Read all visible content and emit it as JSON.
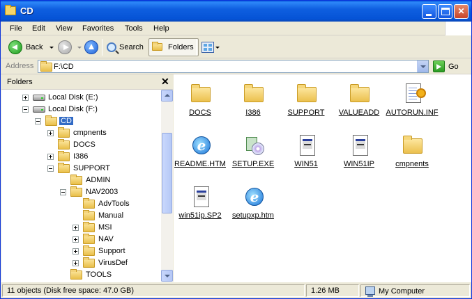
{
  "window": {
    "title": "CD"
  },
  "menu": [
    "File",
    "Edit",
    "View",
    "Favorites",
    "Tools",
    "Help"
  ],
  "toolbar": {
    "back_label": "Back",
    "search_label": "Search",
    "folders_label": "Folders"
  },
  "address": {
    "label": "Address",
    "value": "F:\\CD",
    "go_label": "Go"
  },
  "folders_pane": {
    "title": "Folders",
    "close_glyph": "✕",
    "tree": [
      {
        "label": "Local Disk (E:)",
        "level": 0,
        "expander": "plus",
        "icon": "drive"
      },
      {
        "label": "Local Disk (F:)",
        "level": 0,
        "expander": "minus",
        "icon": "drive"
      },
      {
        "label": "CD",
        "level": 1,
        "expander": "minus",
        "icon": "folder",
        "selected": true
      },
      {
        "label": "cmpnents",
        "level": 2,
        "expander": "plus",
        "icon": "folder"
      },
      {
        "label": "DOCS",
        "level": 2,
        "expander": "none",
        "icon": "folder"
      },
      {
        "label": "I386",
        "level": 2,
        "expander": "plus",
        "icon": "folder"
      },
      {
        "label": "SUPPORT",
        "level": 2,
        "expander": "minus",
        "icon": "folder"
      },
      {
        "label": "ADMIN",
        "level": 3,
        "expander": "none",
        "icon": "folder"
      },
      {
        "label": "NAV2003",
        "level": 3,
        "expander": "minus",
        "icon": "folder"
      },
      {
        "label": "AdvTools",
        "level": 4,
        "expander": "none",
        "icon": "folder"
      },
      {
        "label": "Manual",
        "level": 4,
        "expander": "none",
        "icon": "folder"
      },
      {
        "label": "MSI",
        "level": 4,
        "expander": "plus",
        "icon": "folder"
      },
      {
        "label": "NAV",
        "level": 4,
        "expander": "plus",
        "icon": "folder"
      },
      {
        "label": "Support",
        "level": 4,
        "expander": "plus",
        "icon": "folder"
      },
      {
        "label": "VirusDef",
        "level": 4,
        "expander": "plus",
        "icon": "folder"
      },
      {
        "label": "TOOLS",
        "level": 3,
        "expander": "none",
        "icon": "folder"
      }
    ]
  },
  "files": [
    {
      "name": "DOCS",
      "icon": "folder-icon"
    },
    {
      "name": "I386",
      "icon": "folder-icon"
    },
    {
      "name": "SUPPORT",
      "icon": "folder-icon"
    },
    {
      "name": "VALUEADD",
      "icon": "folder-icon"
    },
    {
      "name": "AUTORUN.INF",
      "icon": "inf-file-icon"
    },
    {
      "name": "README.HTM",
      "icon": "ie-document-icon"
    },
    {
      "name": "SETUP.EXE",
      "icon": "setup-icon"
    },
    {
      "name": "WIN51",
      "icon": "system-file-icon"
    },
    {
      "name": "WIN51IP",
      "icon": "system-file-icon"
    },
    {
      "name": "cmpnents",
      "icon": "folder-icon"
    },
    {
      "name": "win51ip.SP2",
      "icon": "system-file-icon"
    },
    {
      "name": "setupxp.htm",
      "icon": "ie-document-icon"
    }
  ],
  "status": {
    "objects": "11 objects (Disk free space: 47.0 GB)",
    "size": "1.26 MB",
    "location": "My Computer"
  }
}
